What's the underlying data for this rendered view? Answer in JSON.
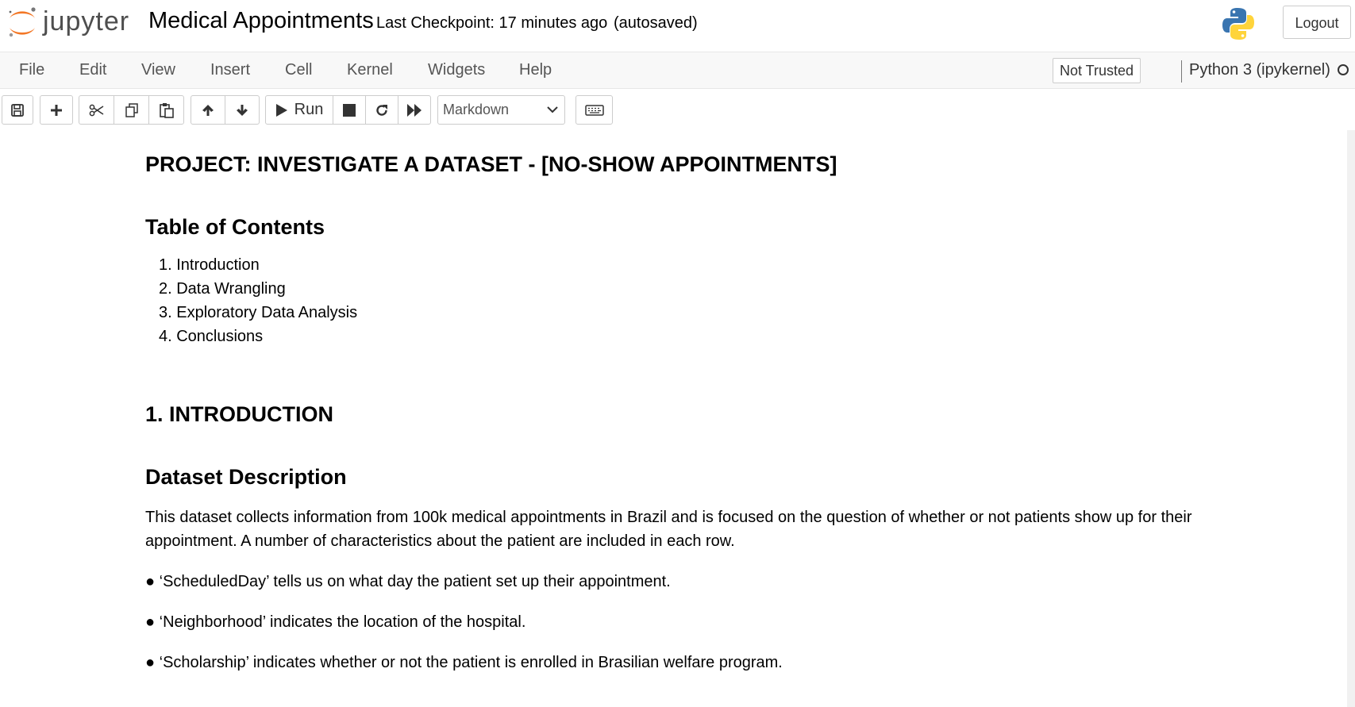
{
  "header": {
    "logo_text": "jupyter",
    "notebook_name": "Medical Appointments",
    "checkpoint": "Last Checkpoint: 17 minutes ago",
    "autosave": "(autosaved)",
    "logout_label": "Logout"
  },
  "menubar": {
    "items": [
      "File",
      "Edit",
      "View",
      "Insert",
      "Cell",
      "Kernel",
      "Widgets",
      "Help"
    ],
    "trust_label": "Not Trusted",
    "kernel_name": "Python 3 (ipykernel)"
  },
  "toolbar": {
    "buttons": [
      "save-icon",
      "plus-icon",
      "scissors-icon",
      "copy-icon",
      "paste-icon",
      "arrow-up-icon",
      "arrow-down-icon",
      "play-icon",
      "stop-icon",
      "restart-icon",
      "fast-forward-icon",
      "keyboard-icon"
    ],
    "run_label": "Run",
    "cell_type": "Markdown"
  },
  "notebook": {
    "title": "PROJECT: INVESTIGATE A DATASET - [NO-SHOW APPOINTMENTS]",
    "toc_heading": "Table of Contents",
    "toc_items": [
      "1. Introduction",
      "2. Data Wrangling",
      "3. Exploratory Data Analysis",
      "4. Conclusions"
    ],
    "intro_heading": "1. INTRODUCTION",
    "dataset_heading": "Dataset Description",
    "description": "This dataset collects information from 100k medical appointments in Brazil and is focused on the question of whether or not patients show up for their appointment. A number of characteristics about the patient are included in each row.",
    "bullets": [
      "● ‘ScheduledDay’ tells us on what day the patient set up their appointment.",
      "● ‘Neighborhood’ indicates the location of the hospital.",
      "● ‘Scholarship’ indicates whether or not the patient is enrolled in Brasilian welfare program."
    ]
  },
  "colors": {
    "jupyter_orange": "#f37726",
    "menubar_bg": "#f8f8f8",
    "python_blue": "#3a75b0",
    "python_yellow": "#ffd43b"
  }
}
